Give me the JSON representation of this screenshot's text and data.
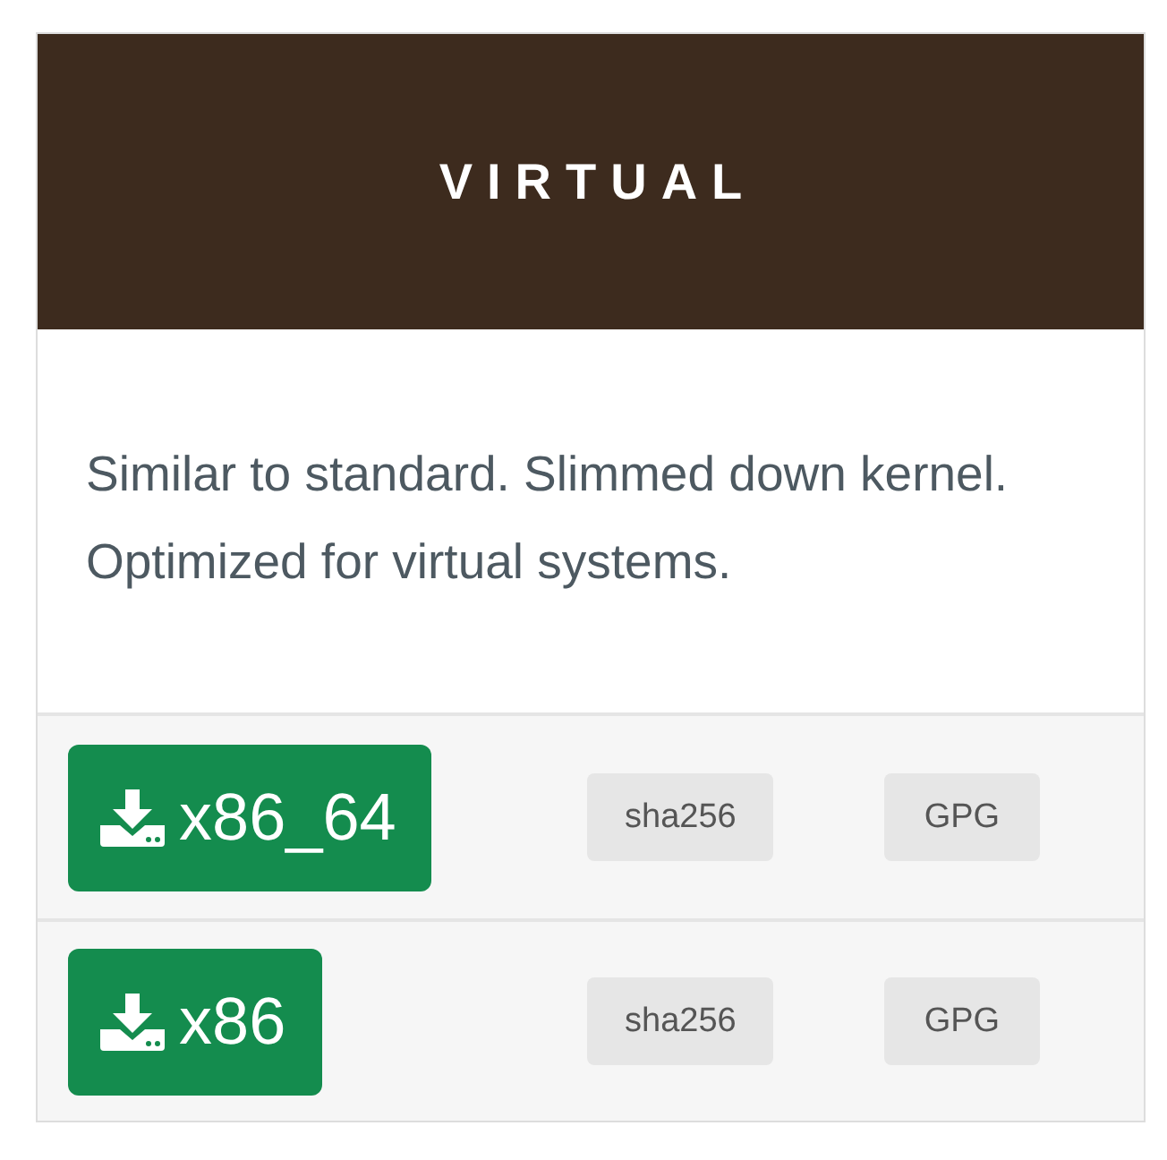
{
  "card": {
    "title": "VIRTUAL",
    "description": "Similar to standard. Slimmed down kernel. Optimized for virtual systems."
  },
  "downloads": [
    {
      "arch": "x86_64",
      "checksum": "sha256",
      "signature": "GPG"
    },
    {
      "arch": "x86",
      "checksum": "sha256",
      "signature": "GPG"
    }
  ]
}
